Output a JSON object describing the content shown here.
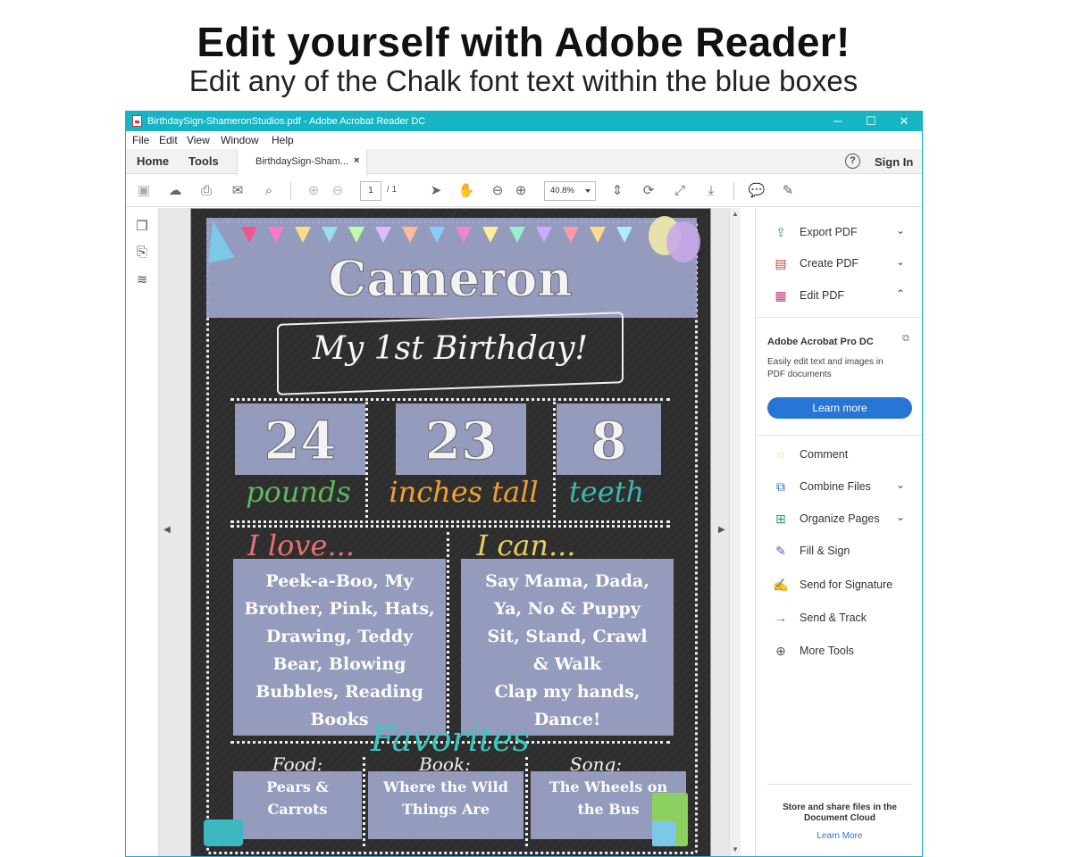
{
  "hero": {
    "title": "Edit yourself with Adobe Reader!",
    "subtitle": "Edit any of the Chalk font text within the blue boxes"
  },
  "window": {
    "title": "BirthdaySign-ShameronStudios.pdf - Adobe Acrobat Reader DC",
    "minimize": "─",
    "maximize": "☐",
    "close": "✕"
  },
  "menu": [
    "File",
    "Edit",
    "View",
    "Window",
    "Help"
  ],
  "tabs": {
    "home": "Home",
    "tools": "Tools",
    "doc": "BirthdaySign-Sham...",
    "doc_close": "×",
    "help": "?",
    "signin": "Sign In"
  },
  "toolbar": {
    "page_current": "1",
    "page_total": "/ 1",
    "zoom": "40.8%"
  },
  "document": {
    "name": "Cameron",
    "banner": "My 1st Birthday!",
    "stats": [
      {
        "value": "24",
        "label": "pounds",
        "color": "#5cb85c"
      },
      {
        "value": "23",
        "label": "inches tall",
        "color": "#f0a030"
      },
      {
        "value": "8",
        "label": "teeth",
        "color": "#3bb8b0"
      }
    ],
    "love_title": "I love...",
    "can_title": "I can...",
    "love": [
      "Peek-a-Boo, My",
      "Brother, Pink, Hats,",
      "Drawing, Teddy",
      "Bear, Blowing",
      "Bubbles, Reading",
      "Books"
    ],
    "can": [
      "Say Mama, Dada,",
      "Ya, No & Puppy",
      "Sit, Stand, Crawl",
      "& Walk",
      "Clap my hands,",
      "Dance!"
    ],
    "favorites": "Favorites",
    "fav": [
      {
        "title": "Food:",
        "lines": [
          "Pears &",
          "Carrots"
        ]
      },
      {
        "title": "Book:",
        "lines": [
          "Where the Wild",
          "Things Are"
        ]
      },
      {
        "title": "Song:",
        "lines": [
          "The Wheels on",
          "the Bus"
        ]
      }
    ]
  },
  "right_panel": {
    "tools": [
      {
        "icon": "⇪",
        "label": "Export PDF",
        "color": "#3a9a5a"
      },
      {
        "icon": "▤",
        "label": "Create PDF",
        "color": "#d04030"
      },
      {
        "icon": "▦",
        "label": "Edit PDF",
        "color": "#c0407a"
      }
    ],
    "promo_title": "Adobe Acrobat Pro DC",
    "promo_text_1": "Easily edit text and images in",
    "promo_text_2": "PDF documents",
    "learn_more_btn": "Learn more",
    "more": [
      {
        "icon": "◌",
        "label": "Comment",
        "color": "#e8b020"
      },
      {
        "icon": "⧉",
        "label": "Combine Files",
        "color": "#2a6fd0"
      },
      {
        "icon": "⊞",
        "label": "Organize Pages",
        "color": "#2a9a6a"
      },
      {
        "icon": "✎",
        "label": "Fill & Sign",
        "color": "#6a4fc8"
      },
      {
        "icon": "✍",
        "label": "Send for Signature",
        "color": "#6a4fc8"
      },
      {
        "icon": "→",
        "label": "Send & Track",
        "color": "#2a6fd0"
      },
      {
        "icon": "⊕",
        "label": "More Tools",
        "color": "#555"
      }
    ],
    "cloud_line1": "Store and share files in the",
    "cloud_line2": "Document Cloud",
    "cloud_link": "Learn More"
  }
}
